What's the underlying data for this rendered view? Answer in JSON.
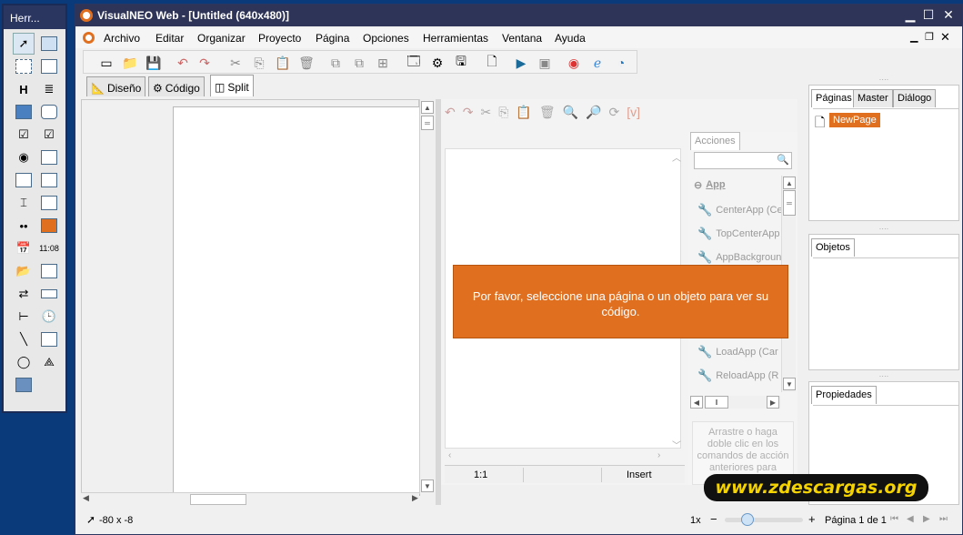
{
  "toolbox": {
    "title": "Herr..."
  },
  "window": {
    "title": "VisualNEO Web - [Untitled (640x480)]"
  },
  "menu": [
    "Archivo",
    "Editar",
    "Organizar",
    "Proyecto",
    "Página",
    "Opciones",
    "Herramientas",
    "Ventana",
    "Ayuda"
  ],
  "view_tabs": {
    "design": "Diseño",
    "code": "Código",
    "split": "Split"
  },
  "message": "Por favor, seleccione una página o un objeto para ver su código.",
  "actions": {
    "tab": "Acciones",
    "category": "App",
    "items": [
      "CenterApp (Ce",
      "TopCenterApp",
      "AppBackgroun",
      "LoadApp (Car",
      "ReloadApp (R"
    ],
    "hint": "Arrastre o haga doble clic en los comandos de acción anteriores para"
  },
  "code_status": {
    "position": "1:1",
    "mode": "Insert"
  },
  "right_panels": {
    "tabs_top": [
      "Páginas",
      "Master",
      "Diálogo"
    ],
    "page_item": "NewPage",
    "objects_tab": "Objetos",
    "props_tab": "Propiedades"
  },
  "status": {
    "coords": "-80 x -8",
    "zoom": "1x",
    "page": "Página 1 de 1"
  },
  "watermark": "www.zdescargas.org",
  "colors": {
    "accent": "#e07020",
    "title": "#2d3457"
  }
}
